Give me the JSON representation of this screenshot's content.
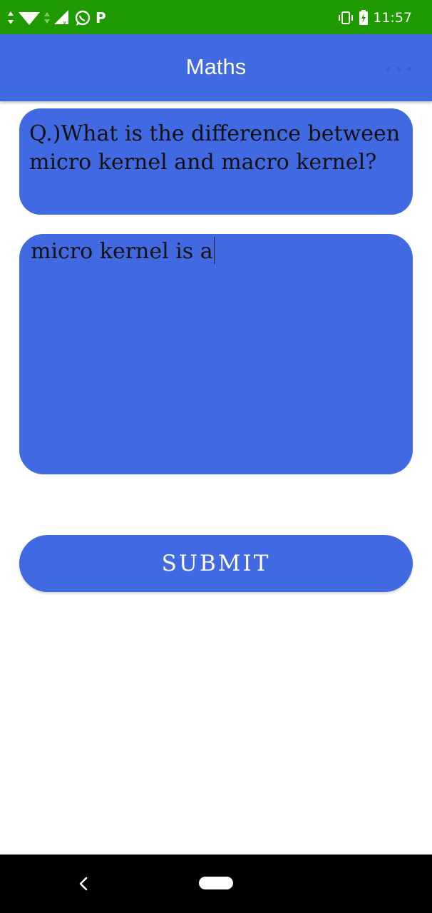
{
  "status_bar": {
    "time": "11:57",
    "p_icon": "P",
    "icons": [
      "data-arrows-icon",
      "wifi-icon",
      "signal-icon",
      "whatsapp-icon",
      "p-icon",
      "vibrate-icon",
      "battery-charging-icon"
    ],
    "background": "#1f9900"
  },
  "app_bar": {
    "title": "Maths",
    "background": "#4169e1",
    "overflow_icon": "more-horizontal-icon"
  },
  "question": {
    "text": "Q.)What is the difference between micro kernel and macro kernel?"
  },
  "answer": {
    "value": "micro kernel is a"
  },
  "submit": {
    "label": "SUBMIT"
  },
  "nav_bar": {
    "back_icon": "back-chevron-icon",
    "home_icon": "home-pill-icon"
  },
  "colors": {
    "accent": "#4169e1",
    "status": "#1f9900",
    "text": "#111111"
  }
}
